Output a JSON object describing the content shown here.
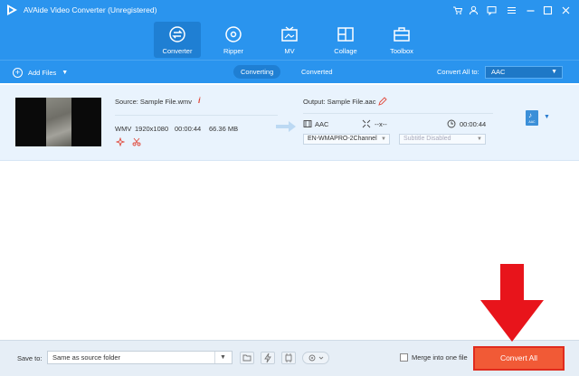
{
  "app": {
    "title": "AVAide Video Converter (Unregistered)"
  },
  "nav": {
    "tabs": [
      {
        "label": "Converter",
        "icon": "converter-icon",
        "active": true
      },
      {
        "label": "Ripper",
        "icon": "ripper-icon",
        "active": false
      },
      {
        "label": "MV",
        "icon": "mv-icon",
        "active": false
      },
      {
        "label": "Collage",
        "icon": "collage-icon",
        "active": false
      },
      {
        "label": "Toolbox",
        "icon": "toolbox-icon",
        "active": false
      }
    ]
  },
  "toolbar": {
    "add_files": "Add Files",
    "tab_converting": "Converting",
    "tab_converted": "Converted",
    "convert_all_to": "Convert All to:",
    "format": "AAC"
  },
  "file": {
    "source": "Source: Sample File.wmv",
    "format": "WMV",
    "resolution": "1920x1080",
    "duration": "00:00:44",
    "size": "66.36 MB",
    "output": "Output: Sample File.aac",
    "out_format": "AAC",
    "out_resolution": "--x--",
    "out_duration": "00:00:44",
    "audio_track": "EN-WMAPRO-2Channel",
    "subtitle": "Subtitle Disabled",
    "badge_label": "AAC"
  },
  "bottom": {
    "save_to": "Save to:",
    "path": "Same as source folder",
    "merge_label": "Merge into one file",
    "convert_button": "Convert All"
  },
  "colors": {
    "header_blue": "#2a94ee",
    "convert_orange": "#f15a36",
    "arrow_red": "#e8141b"
  }
}
